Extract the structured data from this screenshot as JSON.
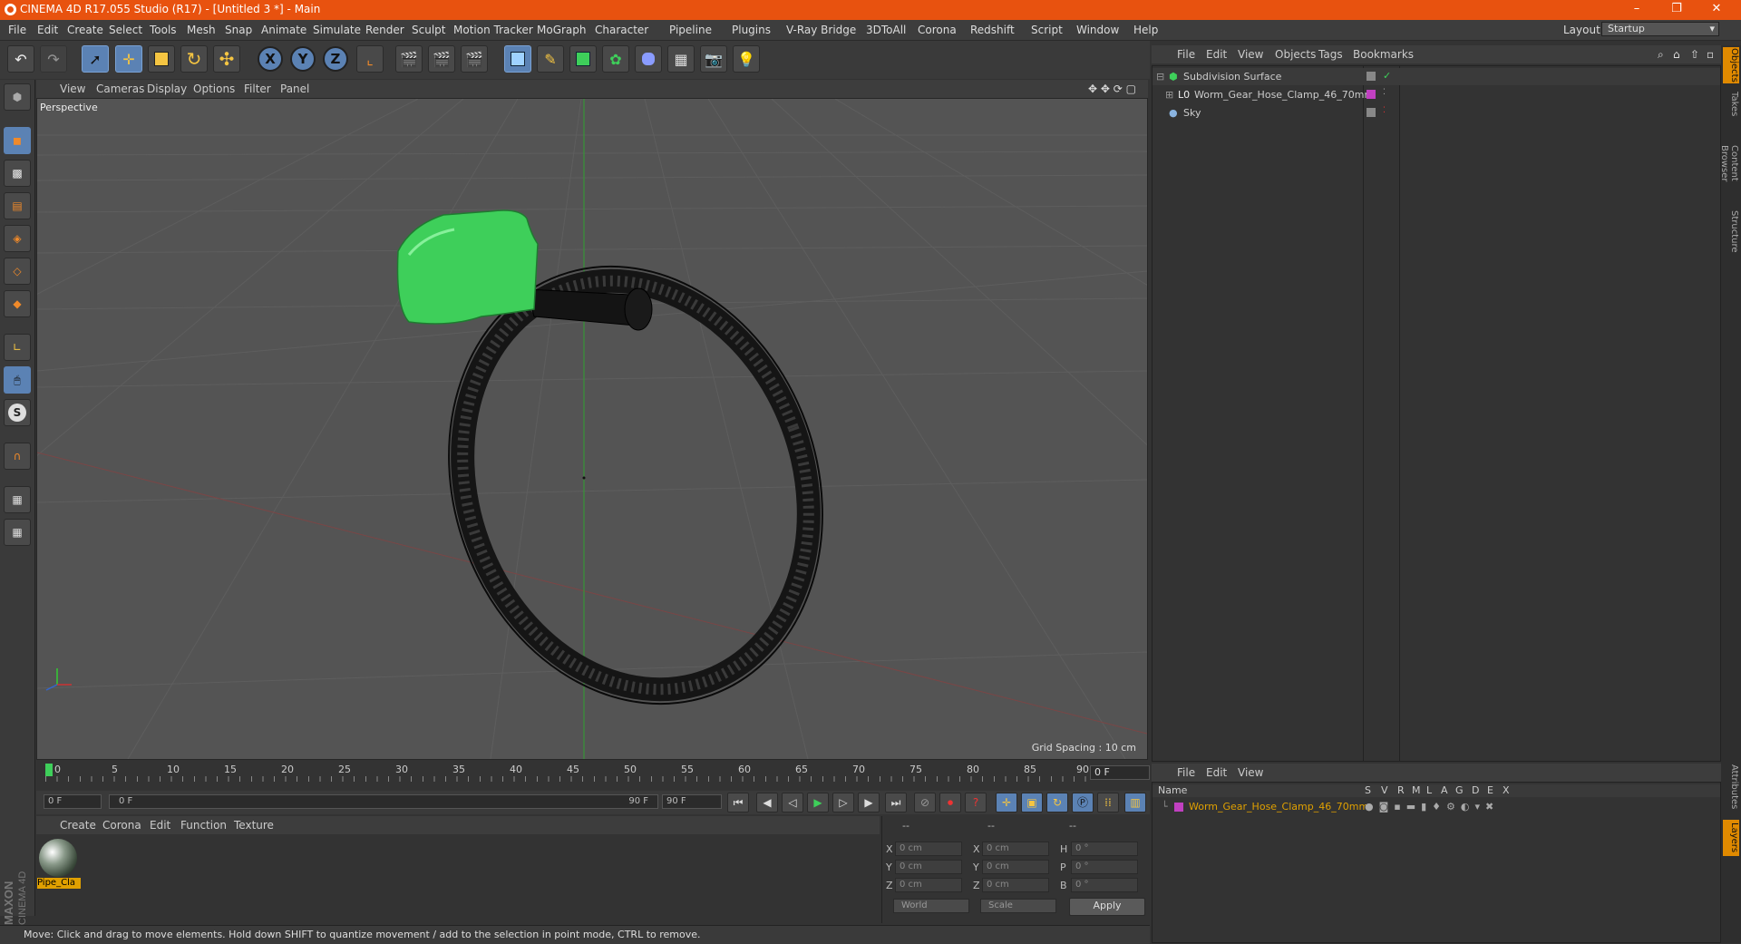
{
  "window": {
    "title": "CINEMA 4D R17.055 Studio (R17) - [Untitled 3 *] - Main",
    "controls": [
      "–",
      "❐",
      "✕"
    ]
  },
  "menubar": {
    "items": [
      "File",
      "Edit",
      "Create",
      "Select",
      "Tools",
      "Mesh",
      "Snap",
      "Animate",
      "Simulate",
      "Render",
      "Sculpt",
      "Motion Tracker",
      "MoGraph",
      "Character",
      "Pipeline",
      "Plugins",
      "V-Ray Bridge",
      "3DToAll",
      "Corona",
      "Redshift",
      "Script",
      "Window",
      "Help"
    ],
    "layout_label": "Layout:",
    "layout_value": "Startup"
  },
  "toolbar": {
    "axis_x": "X",
    "axis_y": "Y",
    "axis_z": "Z"
  },
  "viewport": {
    "menu": [
      "View",
      "Cameras",
      "Display",
      "Options",
      "Filter",
      "Panel"
    ],
    "camera_label": "Perspective",
    "grid_spacing": "Grid Spacing : 10 cm"
  },
  "timeline": {
    "ticks": [
      "0",
      "5",
      "10",
      "15",
      "20",
      "25",
      "30",
      "35",
      "40",
      "45",
      "50",
      "55",
      "60",
      "65",
      "70",
      "75",
      "80",
      "85",
      "90"
    ],
    "current_frame": "0 F",
    "start_field": "0 F",
    "range_start": "0 F",
    "range_end": "90 F",
    "end_field": "90 F"
  },
  "material_manager": {
    "menu": [
      "Create",
      "Corona",
      "Edit",
      "Function",
      "Texture"
    ],
    "materials": [
      {
        "name": "Pipe_Cla"
      }
    ]
  },
  "coordinates": {
    "headers": [
      "--",
      "--",
      "--"
    ],
    "rows": [
      {
        "l1": "X",
        "v1": "0 cm",
        "l2": "X",
        "v2": "0 cm",
        "l3": "H",
        "v3": "0 °"
      },
      {
        "l1": "Y",
        "v1": "0 cm",
        "l2": "Y",
        "v2": "0 cm",
        "l3": "P",
        "v3": "0 °"
      },
      {
        "l1": "Z",
        "v1": "0 cm",
        "l2": "Z",
        "v2": "0 cm",
        "l3": "B",
        "v3": "0 °"
      }
    ],
    "world": "World",
    "scale": "Scale",
    "apply": "Apply"
  },
  "objects_manager": {
    "menu": [
      "File",
      "Edit",
      "View",
      "Objects",
      "Tags",
      "Bookmarks"
    ],
    "objects": [
      {
        "name": "Subdivision Surface"
      },
      {
        "name": "Worm_Gear_Hose_Clamp_46_70mm"
      },
      {
        "name": "Sky"
      }
    ]
  },
  "layers_manager": {
    "menu": [
      "File",
      "Edit",
      "View"
    ],
    "header_name": "Name",
    "flags": [
      "S",
      "V",
      "R",
      "M",
      "L",
      "A",
      "G",
      "D",
      "E",
      "X"
    ],
    "layers": [
      {
        "name": "Worm_Gear_Hose_Clamp_46_70mm",
        "color": "#c040c0"
      }
    ]
  },
  "side_tabs": [
    "Objects",
    "Takes",
    "Content Browser",
    "Structure",
    "Attributes",
    "Layers"
  ],
  "status_bar": {
    "text": "Move: Click and drag to move elements. Hold down SHIFT to quantize movement / add to the selection in point mode, CTRL to remove."
  },
  "branding": {
    "vendor": "MAXON",
    "product": "CINEMA 4D"
  },
  "colors": {
    "titlebar": "#e8520f",
    "active_tool": "#5b82b4",
    "knob_green": "#3ecf5a",
    "layer_orange": "#e0a000"
  }
}
